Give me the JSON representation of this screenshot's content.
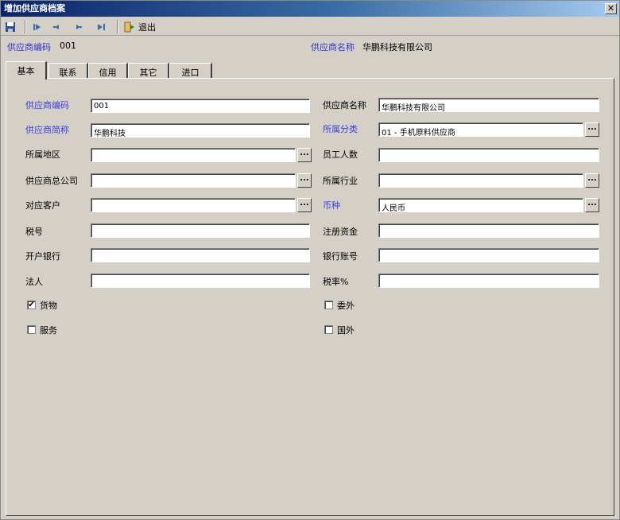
{
  "window": {
    "title": "增加供应商档案"
  },
  "toolbar": {
    "exit_label": "退出"
  },
  "infobar": {
    "code_label": "供应商编码",
    "code_value": "001",
    "name_label": "供应商名称",
    "name_value": "华鹏科技有限公司"
  },
  "tabs": [
    {
      "label": "基本"
    },
    {
      "label": "联系"
    },
    {
      "label": "信用"
    },
    {
      "label": "其它"
    },
    {
      "label": "进口"
    }
  ],
  "form": {
    "left": [
      {
        "label": "供应商编码",
        "value": "001"
      },
      {
        "label": "供应商简称",
        "value": "华鹏科技"
      },
      {
        "label": "所属地区",
        "value": ""
      },
      {
        "label": "供应商总公司",
        "value": ""
      },
      {
        "label": "对应客户",
        "value": ""
      },
      {
        "label": "税号",
        "value": ""
      },
      {
        "label": "开户银行",
        "value": ""
      },
      {
        "label": "法人",
        "value": ""
      }
    ],
    "right": [
      {
        "label": "供应商名称",
        "value": "华鹏科技有限公司"
      },
      {
        "label": "所属分类",
        "value": "01 - 手机原料供应商"
      },
      {
        "label": "员工人数",
        "value": ""
      },
      {
        "label": "所属行业",
        "value": ""
      },
      {
        "label": "币种",
        "value": "人民币"
      },
      {
        "label": "注册资金",
        "value": ""
      },
      {
        "label": "银行账号",
        "value": ""
      },
      {
        "label": "税率%",
        "value": ""
      }
    ],
    "checks": [
      {
        "label": "货物",
        "checked": true
      },
      {
        "label": "服务",
        "checked": false
      },
      {
        "label": "委外",
        "checked": false
      },
      {
        "label": "国外",
        "checked": false
      }
    ],
    "check_mark": "✔",
    "browse_label": "..."
  },
  "colors": {
    "required_label": "#4040e0",
    "title_bar": "#0a246a"
  }
}
